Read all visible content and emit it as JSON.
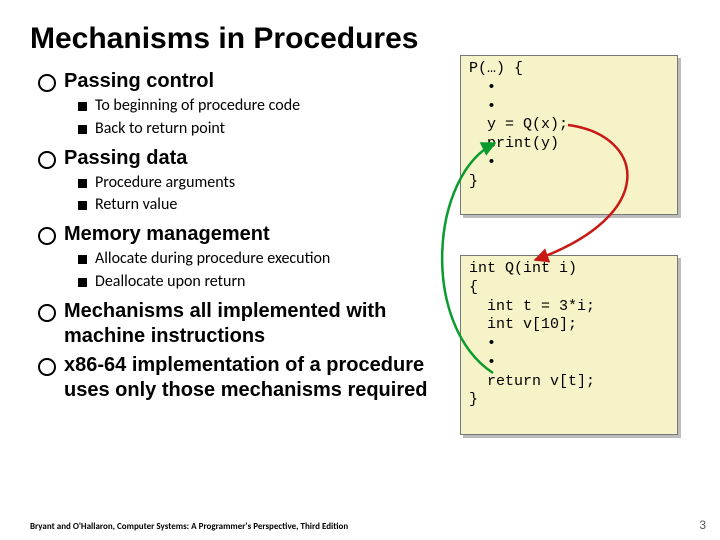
{
  "title": "Mechanisms in Procedures",
  "bullets": [
    {
      "label": "Passing control",
      "subs": [
        "To beginning of procedure code",
        "Back to return point"
      ]
    },
    {
      "label": "Passing data",
      "subs": [
        "Procedure arguments",
        "Return value"
      ]
    },
    {
      "label": "Memory management",
      "subs": [
        "Allocate during procedure execution",
        "Deallocate upon return"
      ]
    },
    {
      "label": "Mechanisms all implemented with machine instructions",
      "subs": []
    },
    {
      "label": "x86-64 implementation of a procedure uses only those mechanisms required",
      "subs": []
    }
  ],
  "code1": "P(…) {\n  •\n  •\n  y = Q(x);\n  print(y)\n  •\n}",
  "code2": "int Q(int i)\n{\n  int t = 3*i;\n  int v[10];\n  •\n  •\n  return v[t];\n}",
  "footer_left": "Bryant and O'Hallaron, Computer Systems: A Programmer's Perspective, Third Edition",
  "footer_right": "3"
}
